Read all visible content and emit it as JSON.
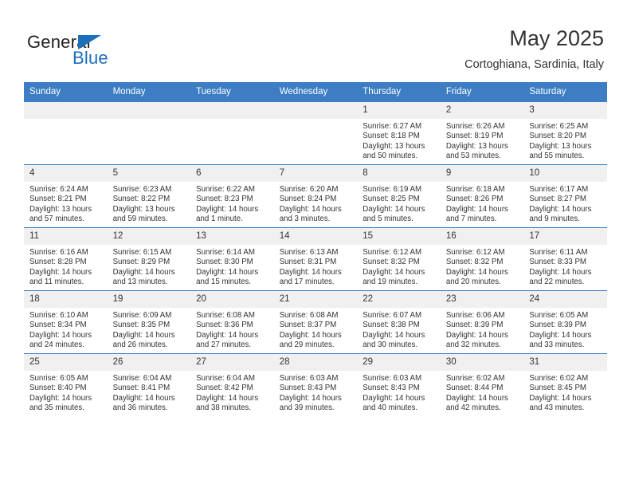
{
  "logo": {
    "word1": "General",
    "word2": "Blue",
    "triangle_icon": "blue-triangle-icon",
    "color_dark": "#231f20",
    "color_blue": "#1c6fba"
  },
  "header": {
    "title": "May 2025",
    "location": "Cortoghiana, Sardinia, Italy"
  },
  "theme": {
    "header_bg": "#3c7dc4",
    "header_text": "#ffffff",
    "daynum_bg": "#f0f0f0",
    "body_text": "#333333"
  },
  "calendar": {
    "weekday_headers": [
      "Sunday",
      "Monday",
      "Tuesday",
      "Wednesday",
      "Thursday",
      "Friday",
      "Saturday"
    ],
    "weeks": [
      [
        {
          "day": "",
          "lines": [
            "",
            "",
            "",
            ""
          ],
          "blank": true
        },
        {
          "day": "",
          "lines": [
            "",
            "",
            "",
            ""
          ],
          "blank": true
        },
        {
          "day": "",
          "lines": [
            "",
            "",
            "",
            ""
          ],
          "blank": true
        },
        {
          "day": "",
          "lines": [
            "",
            "",
            "",
            ""
          ],
          "blank": true
        },
        {
          "day": "1",
          "lines": [
            "Sunrise: 6:27 AM",
            "Sunset: 8:18 PM",
            "Daylight: 13 hours",
            "and 50 minutes."
          ]
        },
        {
          "day": "2",
          "lines": [
            "Sunrise: 6:26 AM",
            "Sunset: 8:19 PM",
            "Daylight: 13 hours",
            "and 53 minutes."
          ]
        },
        {
          "day": "3",
          "lines": [
            "Sunrise: 6:25 AM",
            "Sunset: 8:20 PM",
            "Daylight: 13 hours",
            "and 55 minutes."
          ]
        }
      ],
      [
        {
          "day": "4",
          "lines": [
            "Sunrise: 6:24 AM",
            "Sunset: 8:21 PM",
            "Daylight: 13 hours",
            "and 57 minutes."
          ]
        },
        {
          "day": "5",
          "lines": [
            "Sunrise: 6:23 AM",
            "Sunset: 8:22 PM",
            "Daylight: 13 hours",
            "and 59 minutes."
          ]
        },
        {
          "day": "6",
          "lines": [
            "Sunrise: 6:22 AM",
            "Sunset: 8:23 PM",
            "Daylight: 14 hours",
            "and 1 minute."
          ]
        },
        {
          "day": "7",
          "lines": [
            "Sunrise: 6:20 AM",
            "Sunset: 8:24 PM",
            "Daylight: 14 hours",
            "and 3 minutes."
          ]
        },
        {
          "day": "8",
          "lines": [
            "Sunrise: 6:19 AM",
            "Sunset: 8:25 PM",
            "Daylight: 14 hours",
            "and 5 minutes."
          ]
        },
        {
          "day": "9",
          "lines": [
            "Sunrise: 6:18 AM",
            "Sunset: 8:26 PM",
            "Daylight: 14 hours",
            "and 7 minutes."
          ]
        },
        {
          "day": "10",
          "lines": [
            "Sunrise: 6:17 AM",
            "Sunset: 8:27 PM",
            "Daylight: 14 hours",
            "and 9 minutes."
          ]
        }
      ],
      [
        {
          "day": "11",
          "lines": [
            "Sunrise: 6:16 AM",
            "Sunset: 8:28 PM",
            "Daylight: 14 hours",
            "and 11 minutes."
          ]
        },
        {
          "day": "12",
          "lines": [
            "Sunrise: 6:15 AM",
            "Sunset: 8:29 PM",
            "Daylight: 14 hours",
            "and 13 minutes."
          ]
        },
        {
          "day": "13",
          "lines": [
            "Sunrise: 6:14 AM",
            "Sunset: 8:30 PM",
            "Daylight: 14 hours",
            "and 15 minutes."
          ]
        },
        {
          "day": "14",
          "lines": [
            "Sunrise: 6:13 AM",
            "Sunset: 8:31 PM",
            "Daylight: 14 hours",
            "and 17 minutes."
          ]
        },
        {
          "day": "15",
          "lines": [
            "Sunrise: 6:12 AM",
            "Sunset: 8:32 PM",
            "Daylight: 14 hours",
            "and 19 minutes."
          ]
        },
        {
          "day": "16",
          "lines": [
            "Sunrise: 6:12 AM",
            "Sunset: 8:32 PM",
            "Daylight: 14 hours",
            "and 20 minutes."
          ]
        },
        {
          "day": "17",
          "lines": [
            "Sunrise: 6:11 AM",
            "Sunset: 8:33 PM",
            "Daylight: 14 hours",
            "and 22 minutes."
          ]
        }
      ],
      [
        {
          "day": "18",
          "lines": [
            "Sunrise: 6:10 AM",
            "Sunset: 8:34 PM",
            "Daylight: 14 hours",
            "and 24 minutes."
          ]
        },
        {
          "day": "19",
          "lines": [
            "Sunrise: 6:09 AM",
            "Sunset: 8:35 PM",
            "Daylight: 14 hours",
            "and 26 minutes."
          ]
        },
        {
          "day": "20",
          "lines": [
            "Sunrise: 6:08 AM",
            "Sunset: 8:36 PM",
            "Daylight: 14 hours",
            "and 27 minutes."
          ]
        },
        {
          "day": "21",
          "lines": [
            "Sunrise: 6:08 AM",
            "Sunset: 8:37 PM",
            "Daylight: 14 hours",
            "and 29 minutes."
          ]
        },
        {
          "day": "22",
          "lines": [
            "Sunrise: 6:07 AM",
            "Sunset: 8:38 PM",
            "Daylight: 14 hours",
            "and 30 minutes."
          ]
        },
        {
          "day": "23",
          "lines": [
            "Sunrise: 6:06 AM",
            "Sunset: 8:39 PM",
            "Daylight: 14 hours",
            "and 32 minutes."
          ]
        },
        {
          "day": "24",
          "lines": [
            "Sunrise: 6:05 AM",
            "Sunset: 8:39 PM",
            "Daylight: 14 hours",
            "and 33 minutes."
          ]
        }
      ],
      [
        {
          "day": "25",
          "lines": [
            "Sunrise: 6:05 AM",
            "Sunset: 8:40 PM",
            "Daylight: 14 hours",
            "and 35 minutes."
          ]
        },
        {
          "day": "26",
          "lines": [
            "Sunrise: 6:04 AM",
            "Sunset: 8:41 PM",
            "Daylight: 14 hours",
            "and 36 minutes."
          ]
        },
        {
          "day": "27",
          "lines": [
            "Sunrise: 6:04 AM",
            "Sunset: 8:42 PM",
            "Daylight: 14 hours",
            "and 38 minutes."
          ]
        },
        {
          "day": "28",
          "lines": [
            "Sunrise: 6:03 AM",
            "Sunset: 8:43 PM",
            "Daylight: 14 hours",
            "and 39 minutes."
          ]
        },
        {
          "day": "29",
          "lines": [
            "Sunrise: 6:03 AM",
            "Sunset: 8:43 PM",
            "Daylight: 14 hours",
            "and 40 minutes."
          ]
        },
        {
          "day": "30",
          "lines": [
            "Sunrise: 6:02 AM",
            "Sunset: 8:44 PM",
            "Daylight: 14 hours",
            "and 42 minutes."
          ]
        },
        {
          "day": "31",
          "lines": [
            "Sunrise: 6:02 AM",
            "Sunset: 8:45 PM",
            "Daylight: 14 hours",
            "and 43 minutes."
          ]
        }
      ]
    ]
  }
}
